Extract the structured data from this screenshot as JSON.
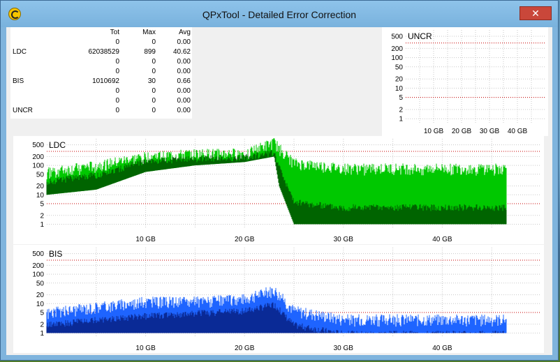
{
  "window": {
    "title": "QPxTool - Detailed Error Correction",
    "close_glyph": "✕"
  },
  "stats": {
    "headers": [
      "Tot",
      "Max",
      "Avg"
    ],
    "rows": [
      {
        "label": "",
        "tot": "0",
        "max": "0",
        "avg": "0.00"
      },
      {
        "label": "LDC",
        "tot": "62038529",
        "max": "899",
        "avg": "40.62"
      },
      {
        "label": "",
        "tot": "0",
        "max": "0",
        "avg": "0.00"
      },
      {
        "label": "",
        "tot": "0",
        "max": "0",
        "avg": "0.00"
      },
      {
        "label": "BIS",
        "tot": "1010692",
        "max": "30",
        "avg": "0.66"
      },
      {
        "label": "",
        "tot": "0",
        "max": "0",
        "avg": "0.00"
      },
      {
        "label": "",
        "tot": "0",
        "max": "0",
        "avg": "0.00"
      },
      {
        "label": "UNCR",
        "tot": "0",
        "max": "0",
        "avg": "0.00"
      }
    ]
  },
  "colors": {
    "ldc_light": "#00c800",
    "ldc_dark": "#006400",
    "bis_light": "#1e64ff",
    "bis_dark": "#0a2a96",
    "threshold": "#c80000"
  },
  "chart_data": [
    {
      "type": "area",
      "title": "UNCR",
      "scale": "log",
      "y_ticks": [
        "1",
        "2",
        "5",
        "10",
        "20",
        "50",
        "100",
        "200",
        "500"
      ],
      "x_ticks": [
        "10 GB",
        "20 GB",
        "30 GB",
        "40 GB"
      ],
      "x_range": [
        0,
        50
      ],
      "y_range": [
        0.7,
        800
      ],
      "series": []
    },
    {
      "type": "area",
      "title": "LDC",
      "scale": "log",
      "y_ticks": [
        "1",
        "2",
        "5",
        "10",
        "20",
        "50",
        "100",
        "200",
        "500"
      ],
      "x_ticks": [
        "10 GB",
        "20 GB",
        "30 GB",
        "40 GB"
      ],
      "x_range": [
        0,
        50
      ],
      "y_range": [
        0.7,
        800
      ],
      "envelope": {
        "x_gb": [
          0,
          5,
          10,
          15,
          20,
          23,
          23.5,
          25,
          30,
          35,
          40,
          46.5
        ],
        "max": [
          60,
          100,
          200,
          250,
          260,
          600,
          400,
          120,
          80,
          80,
          80,
          80
        ],
        "avg": [
          30,
          50,
          150,
          180,
          200,
          300,
          100,
          6,
          4,
          4,
          4,
          4
        ],
        "min": [
          10,
          15,
          60,
          100,
          130,
          200,
          20,
          1,
          1,
          1,
          1,
          1
        ]
      }
    },
    {
      "type": "area",
      "title": "BIS",
      "scale": "log",
      "y_ticks": [
        "1",
        "2",
        "5",
        "10",
        "20",
        "50",
        "100",
        "200",
        "500"
      ],
      "x_ticks": [
        "10 GB",
        "20 GB",
        "30 GB",
        "40 GB"
      ],
      "x_range": [
        0,
        50
      ],
      "y_range": [
        0.7,
        800
      ],
      "envelope": {
        "x_gb": [
          0,
          5,
          10,
          15,
          20,
          23,
          25,
          30,
          46.5
        ],
        "max": [
          5,
          8,
          12,
          12,
          15,
          30,
          6,
          3,
          3
        ],
        "avg": [
          2,
          3,
          4,
          5,
          6,
          10,
          2,
          1,
          1
        ],
        "min": [
          1,
          1,
          1,
          1,
          1,
          1,
          1,
          1,
          1
        ]
      }
    }
  ]
}
